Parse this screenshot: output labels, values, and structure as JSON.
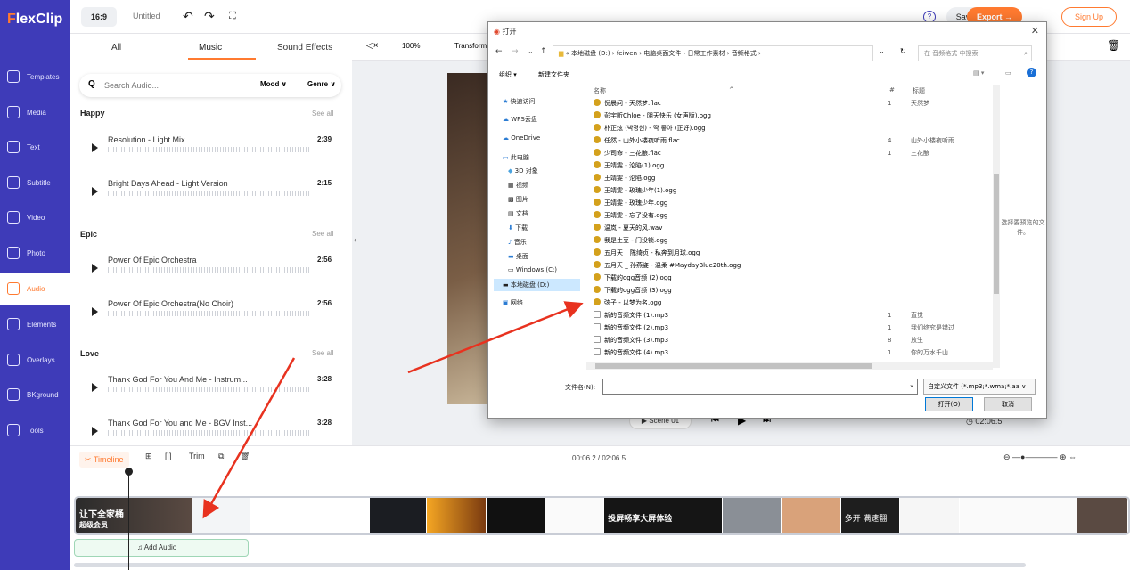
{
  "app": {
    "logo_f": "F",
    "logo_rest": "lexClip"
  },
  "sidebar": {
    "items": [
      {
        "label": "Templates"
      },
      {
        "label": "Media"
      },
      {
        "label": "Text"
      },
      {
        "label": "Subtitle"
      },
      {
        "label": "Video"
      },
      {
        "label": "Photo"
      },
      {
        "label": "Audio"
      },
      {
        "label": "Elements"
      },
      {
        "label": "Overlays"
      },
      {
        "label": "BKground"
      },
      {
        "label": "Tools"
      }
    ]
  },
  "topbar": {
    "ratio": "16:9",
    "title": "Untitled",
    "help": "?",
    "save": "Save",
    "export": "Export →",
    "signup": "Sign Up"
  },
  "panel": {
    "tabs": [
      "All",
      "Music",
      "Sound Effects"
    ],
    "search_placeholder": "Search Audio...",
    "mood": "Mood ∨",
    "genre": "Genre ∨",
    "see_all": "See all",
    "categories": [
      {
        "name": "Happy",
        "tracks": [
          {
            "name": "Resolution - Light Mix",
            "duration": "2:39"
          },
          {
            "name": "Bright Days Ahead - Light Version",
            "duration": "2:15"
          }
        ]
      },
      {
        "name": "Epic",
        "tracks": [
          {
            "name": "Power Of Epic Orchestra",
            "duration": "2:56"
          },
          {
            "name": "Power Of Epic Orchestra(No Choir)",
            "duration": "2:56"
          }
        ]
      },
      {
        "name": "Love",
        "tracks": [
          {
            "name": "Thank God For You And Me - Instrum...",
            "duration": "3:28"
          },
          {
            "name": "Thank God For You and Me - BGV Inst...",
            "duration": "3:28"
          }
        ]
      }
    ]
  },
  "editor": {
    "zoom": "100%",
    "transform": "Transform",
    "scene": "Scene 01",
    "time": "02:06.5"
  },
  "timeline": {
    "label": "Timeline",
    "trim": "Trim",
    "time": "00:06.2 / 02:06.5",
    "add_audio": "Add Audio",
    "clip_text_1": "让下全家桶",
    "clip_text_2": "超级会员",
    "clip_text_3": "投屏畅享大屏体验",
    "clip_text_4": "多开 满速翻"
  },
  "dialog": {
    "title": "打开",
    "path": "« 本地磁盘 (D:) › feiwen › 电脑桌面文件 › 日常工作素材 › 音频格式 ›",
    "search": "在 音频格式 中搜索",
    "organize": "组织 ▾",
    "new_folder": "新建文件夹",
    "col_name": "名称",
    "col_num": "#",
    "col_title": "标题",
    "nav": [
      {
        "label": "快速访问",
        "icon": "star-icon"
      },
      {
        "label": "WPS云盘",
        "icon": "cloud-icon"
      },
      {
        "label": "OneDrive",
        "icon": "cloud-icon"
      },
      {
        "label": "此电脑",
        "icon": "computer-icon"
      },
      {
        "label": "3D 对象",
        "icon": "cube-icon"
      },
      {
        "label": "视频",
        "icon": "video-icon"
      },
      {
        "label": "图片",
        "icon": "image-icon"
      },
      {
        "label": "文档",
        "icon": "document-icon"
      },
      {
        "label": "下载",
        "icon": "download-icon"
      },
      {
        "label": "音乐",
        "icon": "music-icon"
      },
      {
        "label": "桌面",
        "icon": "desktop-icon"
      },
      {
        "label": "Windows (C:)",
        "icon": "drive-icon"
      },
      {
        "label": "本地磁盘 (D:)",
        "icon": "drive-icon"
      },
      {
        "label": "网络",
        "icon": "network-icon"
      }
    ],
    "files": [
      {
        "name": "倪晨问 - 天然梦.flac",
        "num": "1",
        "title": "天然梦"
      },
      {
        "name": "彭宇昕Chloe - 阴天快乐 (女声版).ogg",
        "num": "",
        "title": ""
      },
      {
        "name": "朴正炫 (박정현) - 딱 좋아 (正好).ogg",
        "num": "",
        "title": ""
      },
      {
        "name": "任然 - 山外小楼夜听雨.flac",
        "num": "4",
        "title": "山外小楼夜听雨"
      },
      {
        "name": "少司命 - 三花酿.flac",
        "num": "1",
        "title": "三花酿"
      },
      {
        "name": "王靖雯 - 沦陷(1).ogg",
        "num": "",
        "title": ""
      },
      {
        "name": "王靖雯 - 沦陷.ogg",
        "num": "",
        "title": ""
      },
      {
        "name": "王靖雯 - 玫瑰少年(1).ogg",
        "num": "",
        "title": ""
      },
      {
        "name": "王靖雯 - 玫瑰少年.ogg",
        "num": "",
        "title": ""
      },
      {
        "name": "王靖雯 - 忘了没有.ogg",
        "num": "",
        "title": ""
      },
      {
        "name": "温岚 - 夏天的风.wav",
        "num": "",
        "title": ""
      },
      {
        "name": "我是土豆 - 门没锁.ogg",
        "num": "",
        "title": ""
      },
      {
        "name": "五月天 _ 陈绮贞 - 私奔到月球.ogg",
        "num": "",
        "title": ""
      },
      {
        "name": "五月天 _ 孙燕姿 - 温柔 #MaydayBlue20th.ogg",
        "num": "",
        "title": ""
      },
      {
        "name": "下载的ogg音频 (2).ogg",
        "num": "",
        "title": ""
      },
      {
        "name": "下载的ogg音频 (3).ogg",
        "num": "",
        "title": ""
      },
      {
        "name": "弦子 - 以梦为名.ogg",
        "num": "",
        "title": ""
      },
      {
        "name": "新的音频文件 (1).mp3",
        "num": "1",
        "title": "直觉"
      },
      {
        "name": "新的音频文件 (2).mp3",
        "num": "1",
        "title": "我们终究是错过"
      },
      {
        "name": "新的音频文件 (3).mp3",
        "num": "8",
        "title": "放生"
      },
      {
        "name": "新的音频文件 (4).mp3",
        "num": "1",
        "title": "你的万水千山"
      }
    ],
    "preview": "选择要预览的文件。",
    "filename_label": "文件名(N):",
    "filetype": "自定义文件 (*.mp3;*.wma;*.aa ∨",
    "open": "打开(O)",
    "cancel": "取消"
  }
}
